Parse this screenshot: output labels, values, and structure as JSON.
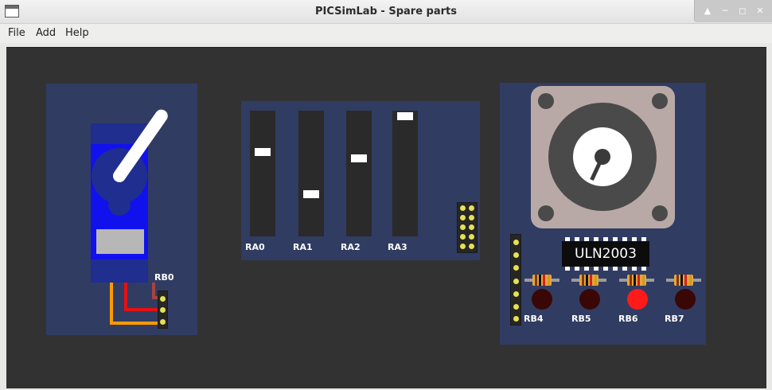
{
  "window": {
    "title": "PICSimLab - Spare parts"
  },
  "menu": {
    "items": [
      "File",
      "Add",
      "Help"
    ]
  },
  "servo": {
    "pin_label": "RB0",
    "arm_angle_deg": 35
  },
  "potentiometers": {
    "channels": [
      {
        "label": "RA0",
        "level": 0.69
      },
      {
        "label": "RA1",
        "level": 0.32
      },
      {
        "label": "RA2",
        "level": 0.63
      },
      {
        "label": "RA3",
        "level": 1.0
      }
    ]
  },
  "stepper": {
    "driver_chip": "ULN2003",
    "shaft_angle_deg": 205,
    "leds": [
      {
        "label": "RB4",
        "on": false
      },
      {
        "label": "RB5",
        "on": false
      },
      {
        "label": "RB6",
        "on": true
      },
      {
        "label": "RB7",
        "on": false
      }
    ]
  },
  "colors": {
    "board": "#313c62",
    "canvas": "#323232",
    "pin": "#e5e155",
    "led_on": "#ff1a1a",
    "led_off": "#3a0707",
    "servo_body": "#1111ee",
    "wire_brown": "#a4453f",
    "wire_red": "#e51010",
    "wire_orange": "#ff9a00"
  }
}
